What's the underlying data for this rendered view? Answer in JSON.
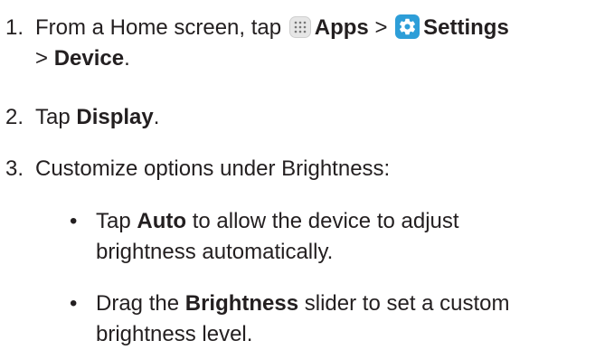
{
  "steps": [
    {
      "number": "1.",
      "line1_prefix": "From a Home screen, tap",
      "apps_label": "Apps",
      "sep1": ">",
      "settings_label": "Settings",
      "sep2": ">",
      "device_label": "Device",
      "end": ".",
      "apps_icon": "apps-grid-icon",
      "settings_icon": "gear-icon"
    },
    {
      "number": "2.",
      "prefix": "Tap",
      "bold": "Display",
      "end": "."
    },
    {
      "number": "3.",
      "text": "Customize options under Brightness:"
    }
  ],
  "bullets": [
    {
      "marker": "•",
      "prefix": "Tap",
      "bold": "Auto",
      "line1_rest": "to allow the device to adjust",
      "line2": "brightness automatically."
    },
    {
      "marker": "•",
      "prefix": "Drag the",
      "bold": "Brightness",
      "line1_rest": "slider to set a custom",
      "line2": "brightness level."
    }
  ],
  "colors": {
    "text": "#231f20",
    "settings_icon_bg": "#2d9ed8",
    "apps_icon_bg": "#e6e6e6"
  }
}
